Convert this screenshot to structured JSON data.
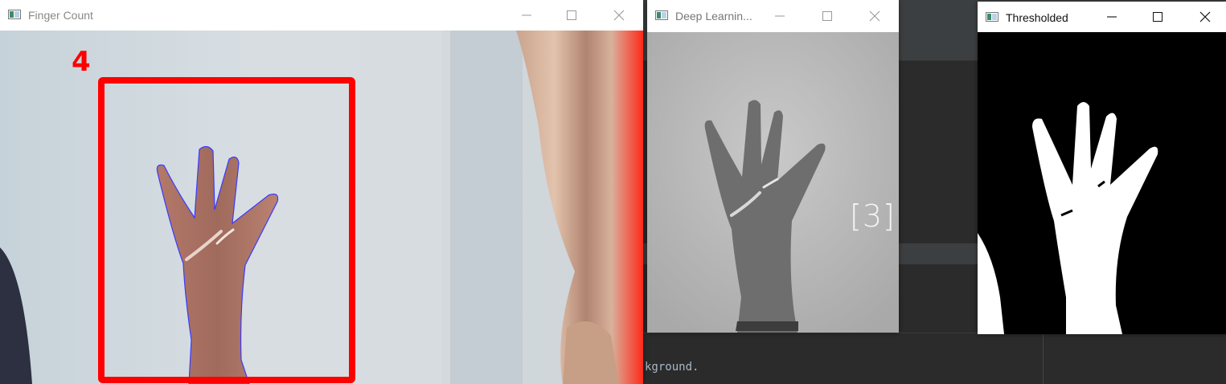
{
  "ide": {
    "console_text": "kground."
  },
  "windows": {
    "finger_count": {
      "title": "Finger Count",
      "count_label": "4"
    },
    "deep_learning": {
      "title": "Deep Learnin...",
      "prediction_label": "[3]"
    },
    "thresholded": {
      "title": "Thresholded"
    }
  },
  "colors": {
    "bounding_box": "#ff0000",
    "hand_contour": "#3a3aff",
    "ide_background": "#2b2b2b"
  },
  "icons": [
    "window-app-icon",
    "minimize-icon",
    "maximize-icon",
    "close-icon"
  ]
}
